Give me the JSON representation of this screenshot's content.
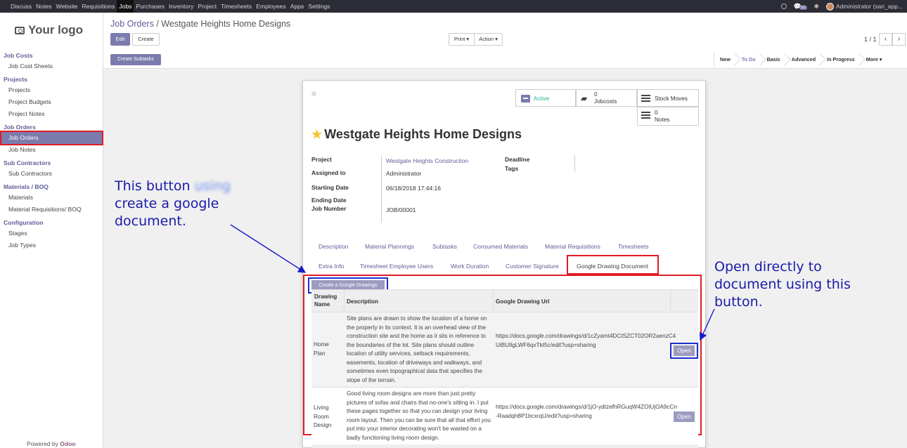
{
  "topbar": {
    "nav": [
      "Discuss",
      "Notes",
      "Website",
      "Requisitions",
      "Jobs",
      "Purchases",
      "Inventory",
      "Project",
      "Timesheets",
      "Employees",
      "Apps",
      "Settings"
    ],
    "active": "Jobs",
    "chat_badge": "10",
    "user": "Administrator (sari_app..."
  },
  "sidebar": {
    "logo": "Your logo",
    "sections": [
      {
        "title": "Job Costs",
        "items": [
          "Job Cost Sheets"
        ]
      },
      {
        "title": "Projects",
        "items": [
          "Projects",
          "Project Budgets",
          "Project Notes"
        ]
      },
      {
        "title": "Job Orders",
        "items": [
          "Job Orders",
          "Job Notes"
        ]
      },
      {
        "title": "Sub Contractors",
        "items": [
          "Sub Contractors"
        ]
      },
      {
        "title": "Materials / BOQ",
        "items": [
          "Materials",
          "Material Requisitions/ BOQ"
        ]
      },
      {
        "title": "Configuration",
        "items": [
          "Stages",
          "Job Types"
        ]
      }
    ],
    "selected": "Job Orders",
    "powered_prefix": "Powered by",
    "powered_brand": "Odoo"
  },
  "controlpanel": {
    "breadcrumb_parent": "Job Orders",
    "breadcrumb_sep": "/",
    "breadcrumb_current": "Westgate Heights Home Designs",
    "edit": "Edit",
    "create": "Create",
    "print": "Print ▾",
    "action": "Action ▾",
    "pager": "1 / 1",
    "prev": "‹",
    "next": "›",
    "create_subtasks": "Create Subtasks",
    "stages": [
      "New",
      "To Do",
      "Basic",
      "Advanced",
      "In Progress",
      "More ▾"
    ],
    "current_stage": "To Do"
  },
  "sheet": {
    "smart_buttons": {
      "active": "Active",
      "jobcosts_count": "0",
      "jobcosts": "Jobcosts",
      "stock_moves": "Stock Moves",
      "notes_count": "0",
      "notes": "Notes"
    },
    "title": "Westgate Heights Home Designs",
    "fields": {
      "project_label": "Project",
      "project": "Westgate Heights Construction",
      "assigned_label": "Assigned to",
      "assigned": "Administrator",
      "start_label": "Starting Date",
      "start": "06/18/2018 17:44:16",
      "end_label": "Ending Date",
      "jobnum_label": "Job Number",
      "jobnum": "JOB/00001",
      "deadline_label": "Deadline",
      "tags_label": "Tags"
    },
    "tabs_row1": [
      "Description",
      "Material Plannings",
      "Subtasks",
      "Consumed Materials",
      "Material Requisitions",
      "Timesheets"
    ],
    "tabs_row2": [
      "Extra Info",
      "Timesheet Employee Users",
      "Work Duration",
      "Customer Signature"
    ],
    "active_tab": "Google Drawing Document",
    "create_drawings": "Create a Google Drawings",
    "columns": [
      "Drawing Name",
      "Description",
      "Google Drawing Url"
    ],
    "rows": [
      {
        "name": "Home Plan",
        "description": "Site plans are drawn to show the location of a home on the property in its context. It is an overhead view of the construction site and the home as it sits in reference to the boundaries of the lot. Site plans should outline location of utility services, setback requirements, easements, location of driveways and walkways, and sometimes even topographical data that specifies the slope of the terrain.",
        "url": "https://docs.google.com/drawings/d/1cZyamt4DCtSZCT02OR2aenzC4UiBUIlgLWF6qxTkt5c/edit?usp=sharing",
        "open": "Open"
      },
      {
        "name": "Living Room Design",
        "description": "Good living room designs are more than just pretty pictures of sofas and chairs that no-one's sitting in. I put these pages together so that you can design your living room layout. Then you can be sure that all that effort you put into your interior decorating won't be wasted on a badly functioning living room design.",
        "url": "https://docs.google.com/drawings/d/1jO-ydtzefhRGuqW4ZOlUjOA9cCn-Raadqh8P1bcxrqU/edit?usp=sharing",
        "open": "Open"
      }
    ]
  },
  "annotations": {
    "left_prefix": "This button",
    "left_blurred": "using",
    "left_rest": "create a google document.",
    "right": "Open directly to document using this button."
  }
}
